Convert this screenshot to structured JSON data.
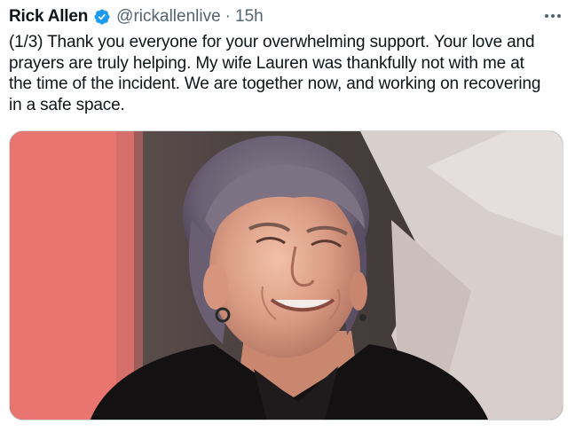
{
  "tweet": {
    "display_name": "Rick Allen",
    "handle": "@rickallenlive",
    "separator": "·",
    "time": "15h",
    "verified": true,
    "text_lines": [
      "(1/3) Thank you everyone for your overwhelming support. Your love and",
      "prayers are truly helping. My wife Lauren was thankfully not with me at",
      "the time of the incident. We are together now, and working on recovering",
      "in a safe space."
    ]
  },
  "icons": {
    "verified": "verified-badge-icon",
    "more": "more-options-icon"
  },
  "colors": {
    "text": "#0f1419",
    "secondary": "#536471",
    "verified_blue": "#1d9bf0",
    "media_border": "#cfd9de"
  }
}
